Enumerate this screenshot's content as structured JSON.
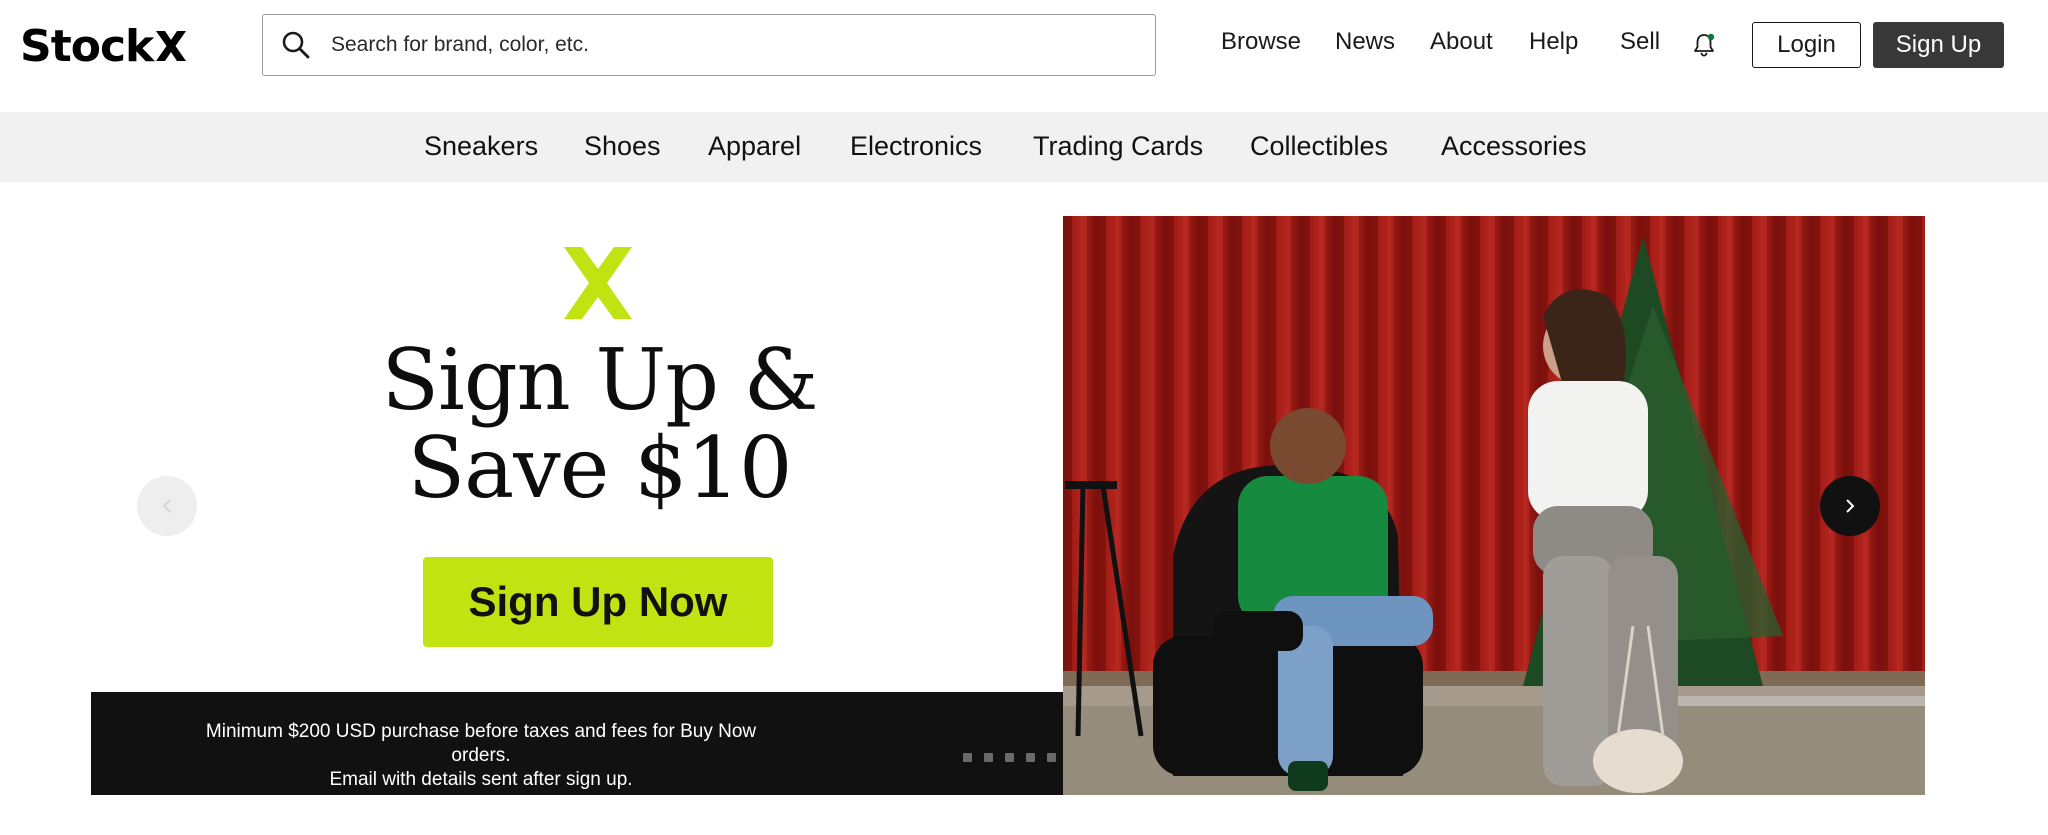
{
  "brand": {
    "logo_text": "Stock",
    "accent_color": "#c2e312"
  },
  "search": {
    "placeholder": "Search for brand, color, etc.",
    "icon": "search-icon"
  },
  "nav": {
    "links": [
      "Browse",
      "News",
      "About",
      "Help",
      "Sell"
    ],
    "notification_icon": "bell-icon",
    "login_label": "Login",
    "signup_label": "Sign Up"
  },
  "categories": [
    "Sneakers",
    "Shoes",
    "Apparel",
    "Electronics",
    "Trading Cards",
    "Collectibles",
    "Accessories"
  ],
  "hero": {
    "title_line1": "Sign Up &",
    "title_line2": "Save $10",
    "cta_label": "Sign Up Now",
    "footnote_line1": "Minimum $200 USD purchase before taxes and fees for Buy Now orders.",
    "footnote_line2": "Email with details sent after sign up.",
    "slide_count": 5,
    "prev_icon": "chevron-left-icon",
    "next_icon": "chevron-right-icon",
    "photo": "two models posing in front of red curtain"
  }
}
